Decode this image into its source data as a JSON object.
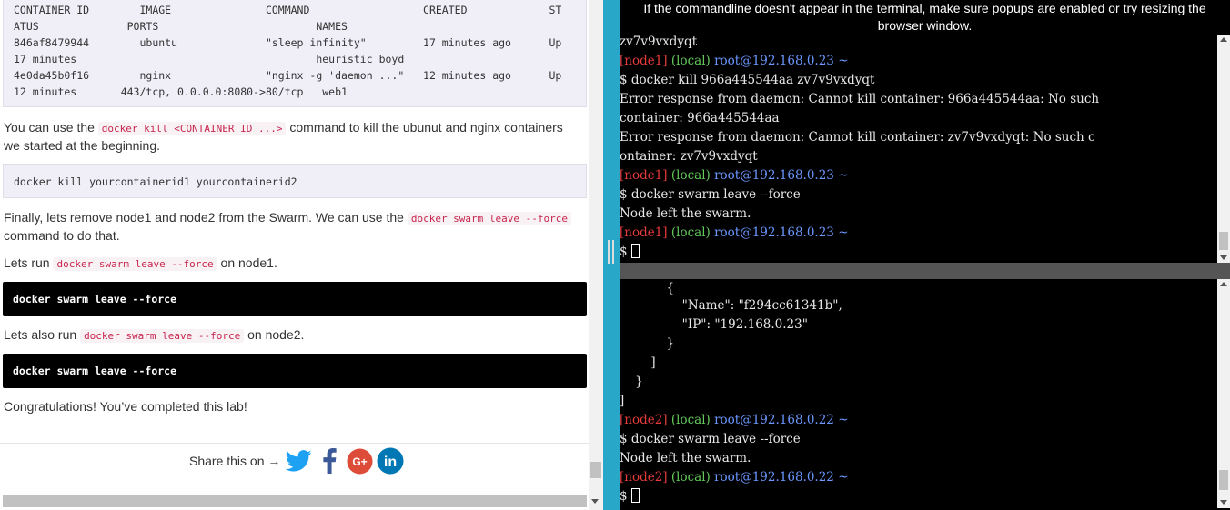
{
  "left": {
    "ps_output": {
      "lines": [
        {
          "text": "CONTAINER ID        IMAGE               COMMAND                  CREATED             ST"
        },
        {
          "text": "ATUS              PORTS                         NAMES"
        },
        {
          "text": "846af8479944        ubuntu              \"sleep infinity\"         17 minutes ago      Up"
        },
        {
          "text": "17 minutes                                      heuristic_boyd"
        },
        {
          "text": "4e0da45b0f16        nginx               \"nginx -g 'daemon ...\"   12 minutes ago      Up"
        },
        {
          "text": "12 minutes       443/tcp, 0.0.0.0:8080->80/tcp   web1"
        }
      ]
    },
    "para_kill": {
      "before": "You can use the ",
      "code": "docker kill <CONTAINER ID ...>",
      "after": " command to kill the ubunut and nginx containers we started at the beginning."
    },
    "kill_cmd": "docker kill yourcontainerid1 yourcontainerid2",
    "para_finally": {
      "before": "Finally, lets remove node1 and node2 from the Swarm. We can use the ",
      "code": "docker swarm leave --force",
      "after": " command to do that."
    },
    "para_node1": {
      "before": "Lets run ",
      "code": "docker swarm leave --force",
      "after": " on node1."
    },
    "cmd_node1": "docker swarm leave --force",
    "para_node2": {
      "before": "Lets also run ",
      "code": "docker swarm leave --force",
      "after": " on node2."
    },
    "cmd_node2": "docker swarm leave --force",
    "congrats": "Congratulations! You’ve completed this lab!",
    "share": {
      "label": "Share this on →",
      "icons": [
        "twitter-icon",
        "facebook-icon",
        "google-plus-icon",
        "linkedin-icon"
      ]
    }
  },
  "right": {
    "notice": "If the commandline doesn't appear in the terminal, make sure popups are enabled or try resizing the browser window.",
    "term1": {
      "line_top": "zv7v9vxdyqt",
      "prompt_node": "[node1]",
      "prompt_local": "(local)",
      "prompt_user": "root@192.168.0.23",
      "prompt_path": "~",
      "cmd_kill": "$ docker kill 966a445544aa zv7v9vxdyqt",
      "err1a": "Error response from daemon: Cannot kill container: 966a445544aa: No such",
      "err1b": "container: 966a445544aa",
      "err2a": "Error response from daemon: Cannot kill container: zv7v9vxdyqt: No such c",
      "err2b": "ontainer: zv7v9vxdyqt",
      "cmd_leave": "$ docker swarm leave --force",
      "leave_out": "Node left the swarm.",
      "prompt_char": "$"
    },
    "term2": {
      "json_lines": [
        "            {",
        "                \"Name\": \"f294cc61341b\",",
        "                \"IP\": \"192.168.0.23\"",
        "            }",
        "        ]",
        "    }",
        "]"
      ],
      "prompt_node": "[node2]",
      "prompt_local": "(local)",
      "prompt_user": "root@192.168.0.22",
      "prompt_path": "~",
      "cmd_leave": "$ docker swarm leave --force",
      "leave_out": "Node left the swarm.",
      "prompt_char": "$"
    }
  },
  "colors": {
    "prompt_red": "#e53b3b",
    "prompt_green": "#63c95b",
    "prompt_blue": "#6b97ff",
    "divider": "#29a7c9",
    "code_red": "#c7254e"
  }
}
